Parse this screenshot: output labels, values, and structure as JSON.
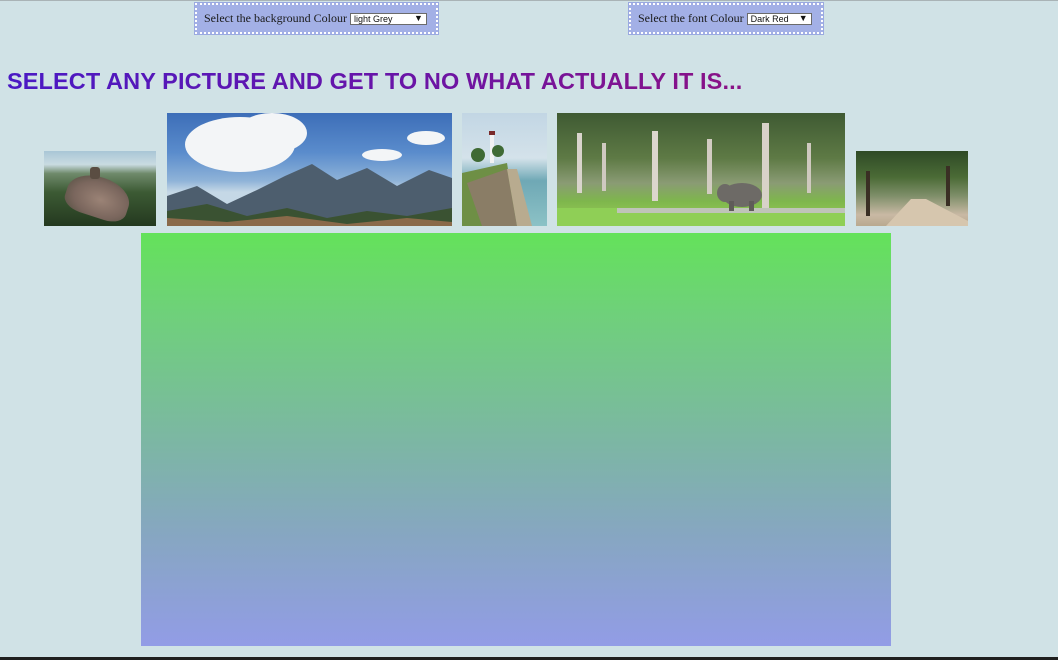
{
  "background_selector": {
    "label": "Select the background Colour",
    "selected": "light Grey",
    "arrow": "▼"
  },
  "font_selector": {
    "label": "Select the font Colour",
    "selected": "Dark Red",
    "arrow": "▼"
  },
  "headline": "SELECT ANY PICTURE AND GET TO NO WHAT ACTUALLY IT IS...",
  "colors": {
    "page_background": "#d0e2e6",
    "selector_background": "#a3b0e6",
    "headline_start": "#4a19c4",
    "headline_end": "#8a1285",
    "panel_top": "#64e25a",
    "panel_bottom": "#929ce6"
  },
  "gallery": [
    {
      "subject": "rock peak"
    },
    {
      "subject": "mountain range"
    },
    {
      "subject": "coastal wall and lighthouse"
    },
    {
      "subject": "elephant under trees"
    },
    {
      "subject": "path through woods"
    }
  ]
}
